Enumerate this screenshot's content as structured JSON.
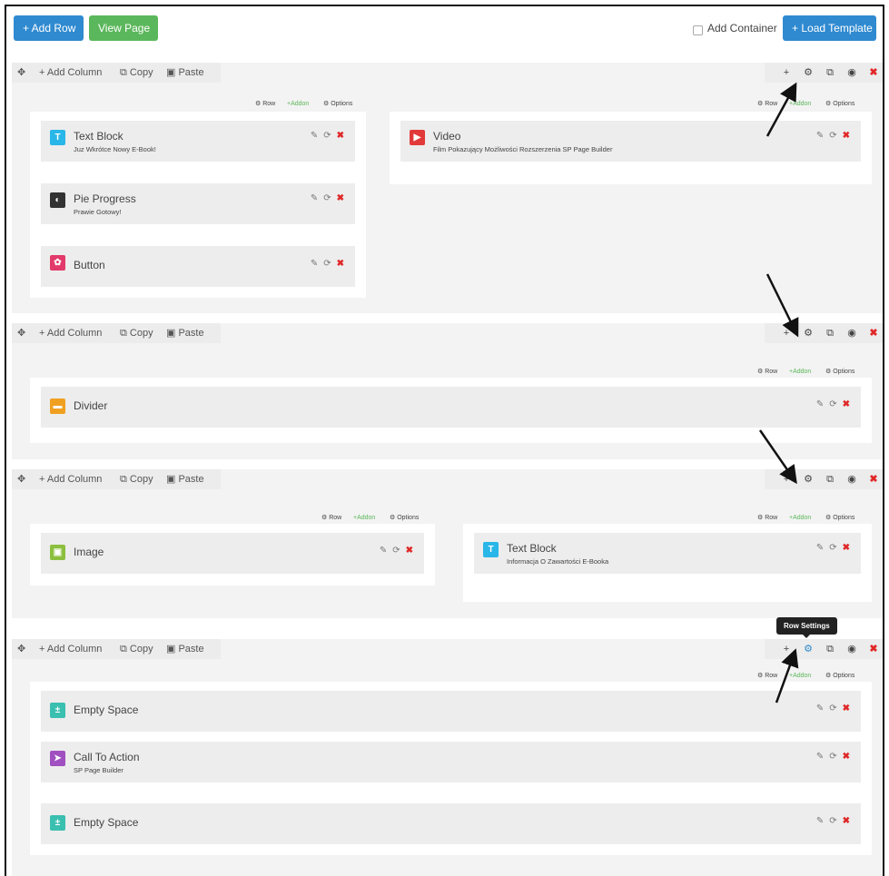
{
  "toolbar": {
    "add_row": "+ Add Row",
    "view_page": "View Page",
    "add_container": "Add Container",
    "load_template": "+ Load Template"
  },
  "row_bar": {
    "move": "✥",
    "add_column": "+ Add Column",
    "copy": "⧉ Copy",
    "paste": "▣ Paste"
  },
  "row_tools": {
    "add": "+",
    "settings": "⚙",
    "copy": "⧉",
    "toggle": "◉",
    "delete": "✖"
  },
  "col_meta": {
    "row": "⚙ Row",
    "addon": "+Addon",
    "options": "⚙ Options"
  },
  "addon_actions": {
    "edit": "✎",
    "refresh": "⟳",
    "delete": "✖"
  },
  "tooltip": "Row Settings",
  "rows": [
    {
      "columns": [
        {
          "addons": [
            {
              "title": "Text Block",
              "subtitle": "Juz Wkrótce Nowy E-Book!",
              "icon": "T",
              "color": "#29b6e8"
            },
            {
              "title": "Pie Progress",
              "subtitle": "Prawie Gotowy!",
              "icon": "◐",
              "color": "#333333"
            },
            {
              "title": "Button",
              "subtitle": "",
              "icon": "✿",
              "color": "#e23a6a"
            }
          ]
        },
        {
          "addons": [
            {
              "title": "Video",
              "subtitle": "Film Pokazujący Możliwości Rozszerzenia SP Page Builder",
              "icon": "▶",
              "color": "#e23a3a"
            }
          ]
        }
      ]
    },
    {
      "columns": [
        {
          "addons": [
            {
              "title": "Divider",
              "subtitle": "",
              "icon": "▬",
              "color": "#f0a020"
            }
          ]
        }
      ]
    },
    {
      "columns": [
        {
          "addons": [
            {
              "title": "Image",
              "subtitle": "",
              "icon": "▣",
              "color": "#8cbf3f"
            }
          ]
        },
        {
          "addons": [
            {
              "title": "Text Block",
              "subtitle": "Informacja O Zawartości E-Booka",
              "icon": "T",
              "color": "#29b6e8"
            }
          ]
        }
      ]
    },
    {
      "columns": [
        {
          "addons": [
            {
              "title": "Empty Space",
              "subtitle": "",
              "icon": "±",
              "color": "#3bbfb0"
            },
            {
              "title": "Call To Action",
              "subtitle": "SP Page Builder",
              "icon": "➤",
              "color": "#a050c0"
            },
            {
              "title": "Empty Space",
              "subtitle": "",
              "icon": "±",
              "color": "#3bbfb0"
            }
          ]
        }
      ]
    }
  ]
}
